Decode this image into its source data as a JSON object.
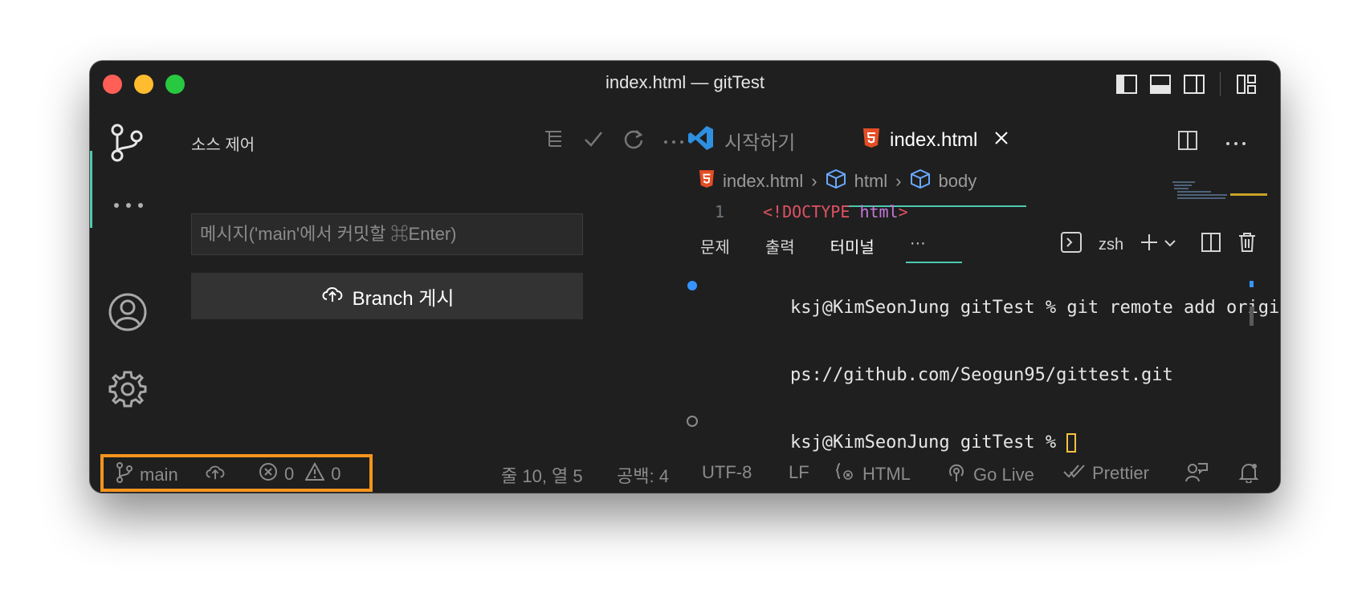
{
  "window": {
    "title": "index.html — gitTest"
  },
  "activity_bar": {
    "icons": [
      "source-control-icon",
      "more-icon",
      "account-icon",
      "settings-gear-icon"
    ]
  },
  "sidebar": {
    "title": "소스 제어",
    "commit_placeholder": "메시지('main'에서 커밋할 ⌘Enter)",
    "publish_button": "Branch 게시"
  },
  "editor": {
    "tabs": [
      {
        "label": "시작하기",
        "active": false
      },
      {
        "label": "index.html",
        "active": true
      }
    ],
    "breadcrumb": [
      "index.html",
      "html",
      "body"
    ],
    "code": {
      "line_number": "1",
      "open": "<!",
      "keyword": "DOCTYPE",
      "space": " ",
      "attr": "html",
      "close": ">"
    }
  },
  "panel": {
    "tabs": [
      "문제",
      "출력",
      "터미널",
      "···"
    ],
    "active_tab": "터미널",
    "shell": "zsh",
    "terminal_lines": [
      "ksj@KimSeonJung gitTest % git remote add origin htt",
      "ps://github.com/Seogun95/gittest.git",
      "ksj@KimSeonJung gitTest % "
    ]
  },
  "status_bar": {
    "branch": "main",
    "errors": "0",
    "warnings": "0",
    "position": "줄 10, 열 5",
    "spaces": "공백: 4",
    "encoding": "UTF-8",
    "eol": "LF",
    "language": "HTML",
    "go_live": "Go Live",
    "prettier": "Prettier"
  },
  "colors": {
    "accent": "#4ec9b0",
    "highlight": "#f7941d",
    "html_icon": "#e44d26",
    "vscode_blue": "#2f8fe0"
  }
}
